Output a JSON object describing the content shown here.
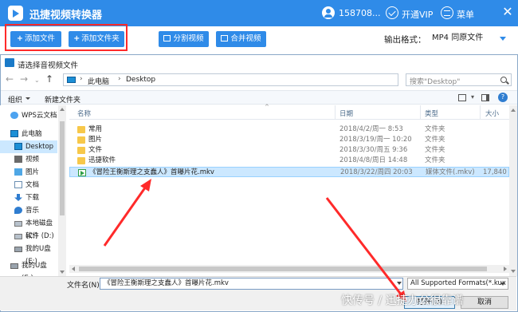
{
  "app": {
    "title": "迅捷视频转换器",
    "user": "158708...",
    "vip": "开通VIP",
    "menu": "菜单",
    "close": "✕"
  },
  "toolbar": {
    "add_file": "添加文件",
    "add_folder": "添加文件夹",
    "split_video": "分割视频",
    "merge_video": "合并视频",
    "format_label": "输出格式：",
    "format_value": "MP4  同原文件"
  },
  "dialog": {
    "title": "请选择音视频文件",
    "address": {
      "pc": "此电脑",
      "location": "Desktop",
      "sep": "›"
    },
    "search_placeholder": "搜索\"Desktop\"",
    "organize": "组织",
    "new_folder": "新建文件夹",
    "help": "?",
    "nav_items": [
      {
        "label": "WPS云文档",
        "icon": "cloud-icon"
      },
      {
        "label": "此电脑",
        "icon": "computer-icon"
      },
      {
        "label": "Desktop",
        "icon": "desktop-icon"
      },
      {
        "label": "视频",
        "icon": "video-folder-icon"
      },
      {
        "label": "图片",
        "icon": "picture-folder-icon"
      },
      {
        "label": "文档",
        "icon": "document-folder-icon"
      },
      {
        "label": "下载",
        "icon": "download-folder-icon"
      },
      {
        "label": "音乐",
        "icon": "music-folder-icon"
      },
      {
        "label": "本地磁盘 (C:)",
        "icon": "drive-icon"
      },
      {
        "label": "软件 (D:)",
        "icon": "drive-icon"
      },
      {
        "label": "我的U盘 (E:)",
        "icon": "usb-drive-icon"
      },
      {
        "label": "我的U盘 (E:)",
        "icon": "usb-drive-icon"
      }
    ],
    "columns": {
      "name": "名称",
      "date": "日期",
      "type": "类型",
      "size": "大小"
    },
    "files": [
      {
        "name": "常用",
        "date": "2018/4/2/周一 8:53",
        "type": "文件夹",
        "size": "",
        "icon": "folder-icon"
      },
      {
        "name": "图片",
        "date": "2018/3/19/周一 10:20",
        "type": "文件夹",
        "size": "",
        "icon": "folder-icon"
      },
      {
        "name": "文件",
        "date": "2018/3/30/周五 9:36",
        "type": "文件夹",
        "size": "",
        "icon": "folder-icon"
      },
      {
        "name": "迅捷软件",
        "date": "2018/4/8/周日 14:48",
        "type": "文件夹",
        "size": "",
        "icon": "folder-icon"
      },
      {
        "name": "《冒险王衡斯理之支蠢人》首曝片花.mkv",
        "date": "2018/3/22/周四 20:03",
        "type": "媒体文件(.mkv)",
        "size": "17,840 K",
        "icon": "video-file-icon"
      }
    ],
    "filename_label": "文件名(N):",
    "filename_value": "《冒险王衡斯理之支蠢人》首曝片花.mkv",
    "filter_value": "All Supported Formats(*.kux",
    "open_button": "打开(O)",
    "cancel_button": "取消"
  },
  "watermark": "快传号 / 迅捷办公很靠谱",
  "colors": {
    "brand_blue": "#2f8be8",
    "annotation_red": "#ff2a2a",
    "selection": "#cce8ff"
  }
}
